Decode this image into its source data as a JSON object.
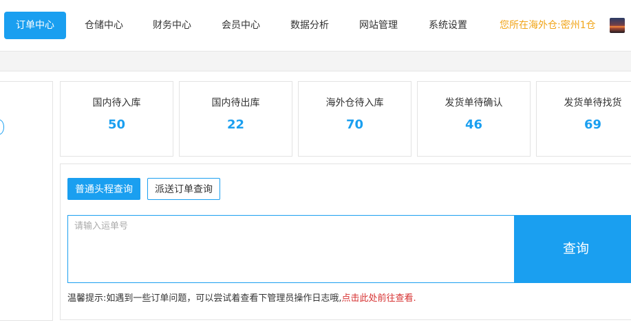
{
  "nav": {
    "items": [
      {
        "label": "订单中心",
        "active": true
      },
      {
        "label": "仓储中心",
        "active": false
      },
      {
        "label": "财务中心",
        "active": false
      },
      {
        "label": "会员中心",
        "active": false
      },
      {
        "label": "数据分析",
        "active": false
      },
      {
        "label": "网站管理",
        "active": false
      },
      {
        "label": "系统设置",
        "active": false
      }
    ],
    "location": "您所在海外仓:密州1仓"
  },
  "stats": [
    {
      "label": "国内待入库",
      "value": "50"
    },
    {
      "label": "国内待出库",
      "value": "22"
    },
    {
      "label": "海外仓待入库",
      "value": "70"
    },
    {
      "label": "发货单待确认",
      "value": "46"
    },
    {
      "label": "发货单待找货",
      "value": "69"
    }
  ],
  "query": {
    "tabs": [
      "普通头程查询",
      "派送订单查询"
    ],
    "placeholder": "请输入运单号",
    "button": "查询",
    "tip": "温馨提示:如遇到一些订单问题，可以尝试着查看下管理员操作日志哦,",
    "tip_link": "点击此处前往查看."
  },
  "colors": {
    "accent": "#1a9ff0",
    "location": "#f1a417",
    "link": "#d63030"
  }
}
